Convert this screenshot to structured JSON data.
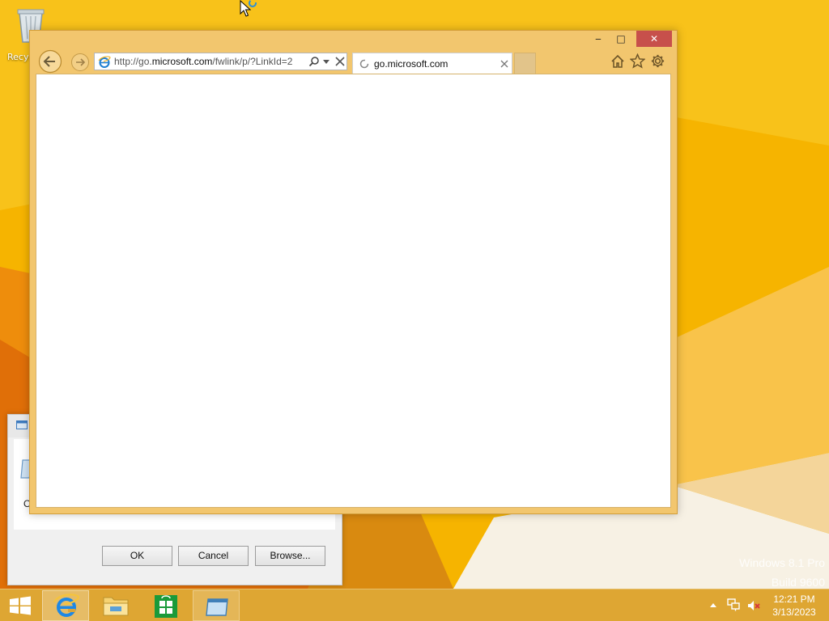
{
  "desktop": {
    "recycle_bin_label": "Recycle Bin",
    "watermark": {
      "line1": "Windows 8.1 Pro",
      "line2": "Build 9600"
    }
  },
  "background_dialog": {
    "open_label": "O",
    "buttons": {
      "ok": "OK",
      "cancel": "Cancel",
      "browse": "Browse..."
    }
  },
  "browser": {
    "window_controls": {
      "minimize": "‒",
      "maximize": "□",
      "close": "✕"
    },
    "address": {
      "prefix": "http://go.",
      "domain": "microsoft.com",
      "suffix": "/fwlink/p/?LinkId=2"
    },
    "tab": {
      "title": "go.microsoft.com"
    },
    "colors": {
      "frame": "#f2c66e",
      "close_button": "#c7504b"
    }
  },
  "taskbar": {
    "apps": [
      "internet-explorer",
      "file-explorer",
      "windows-store",
      "run-dialog"
    ],
    "clock": {
      "time": "12:21 PM",
      "date": "3/13/2023"
    }
  },
  "icons": {
    "back": "back-arrow-icon",
    "forward": "forward-arrow-icon",
    "home": "home-icon",
    "favorites": "star-icon",
    "settings": "gear-icon"
  }
}
